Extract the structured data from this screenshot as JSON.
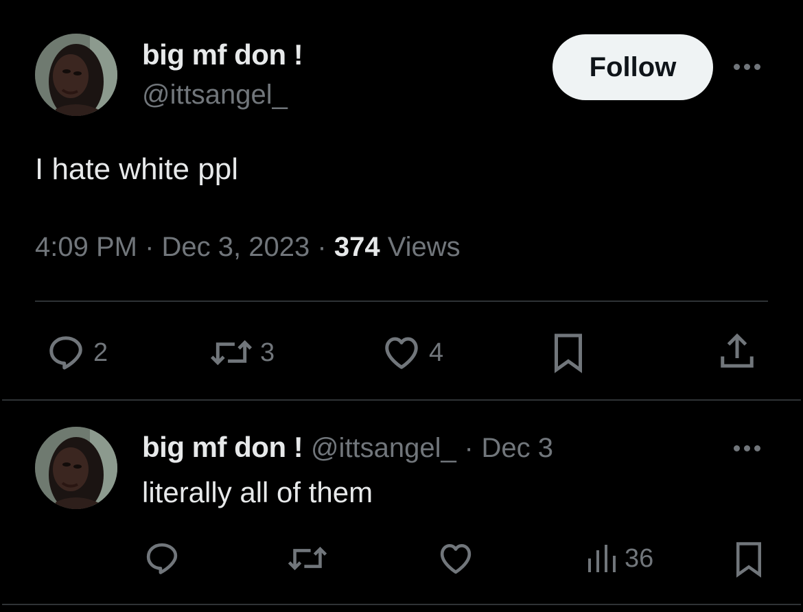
{
  "main_tweet": {
    "display_name": "big mf don !",
    "handle": "@ittsangel_",
    "follow_label": "Follow",
    "text": "I hate white ppl",
    "time": "4:09 PM",
    "date": "Dec 3, 2023",
    "views_count": "374",
    "views_label": "Views",
    "separator": "·",
    "actions": {
      "replies": "2",
      "retweets": "3",
      "likes": "4"
    }
  },
  "reply_tweet": {
    "display_name": "big mf don !",
    "handle": "@ittsangel_",
    "separator": "·",
    "date": "Dec 3",
    "text": "literally all of them",
    "actions": {
      "views": "36"
    }
  },
  "icons": [
    "more-icon",
    "reply-icon",
    "retweet-icon",
    "like-icon",
    "bookmark-icon",
    "share-icon",
    "views-icon"
  ],
  "colors": {
    "background": "#000000",
    "text_primary": "#e7e9ea",
    "text_secondary": "#71767b",
    "divider": "#2f3336",
    "follow_button_bg": "#eff3f4"
  }
}
